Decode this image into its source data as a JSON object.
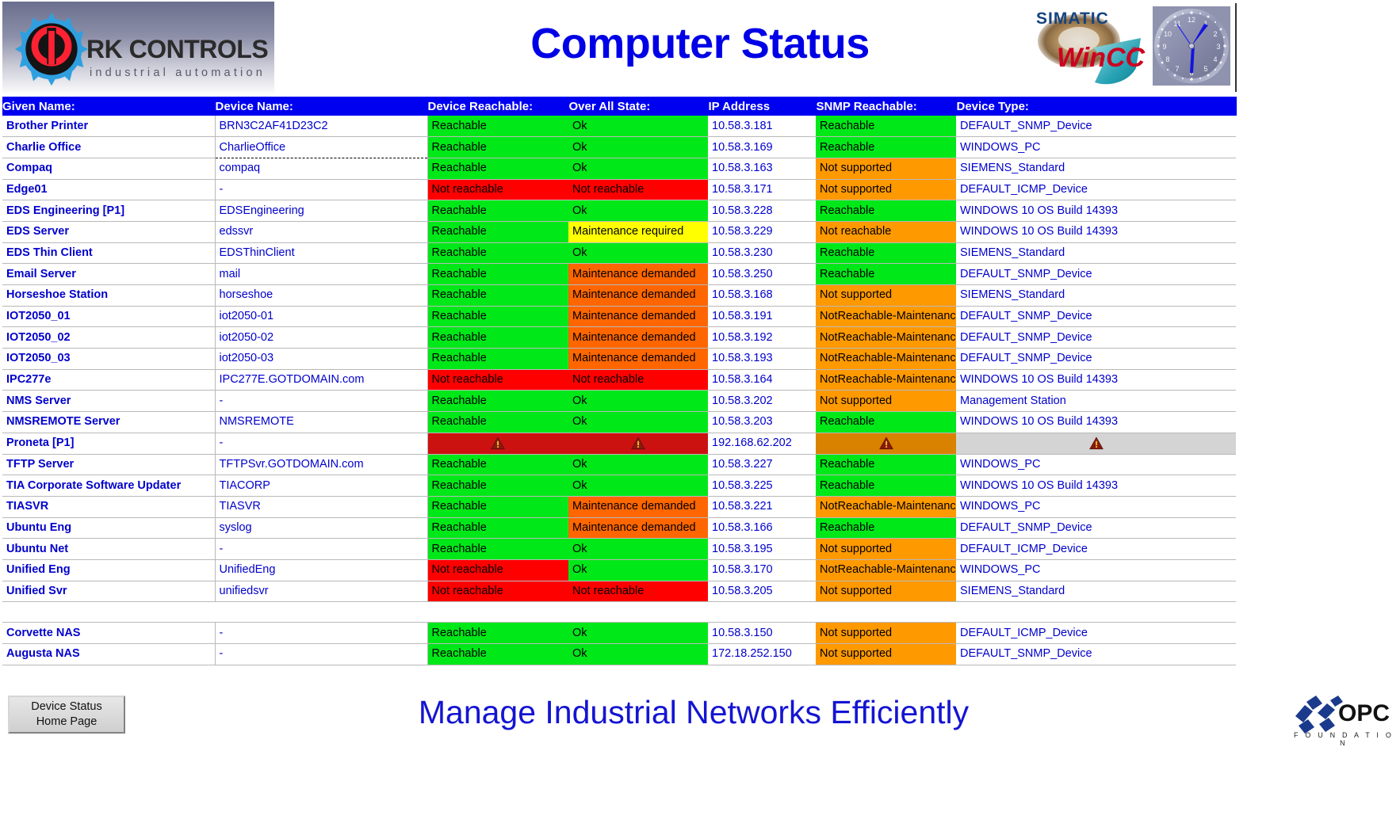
{
  "header": {
    "title": "Computer Status",
    "logo": {
      "name": "RK CONTROLS",
      "tagline": "industrial automation",
      "icon": "gear-power-icon"
    },
    "wincc_logo": {
      "line1": "SIMATIC",
      "line2": "WinCC",
      "trademark": "®",
      "icon": "simatic-wincc-logo"
    },
    "clock": {
      "icon": "analog-clock",
      "numerals": [
        "12",
        "1",
        "2",
        "3",
        "4",
        "5",
        "6",
        "7",
        "8",
        "9",
        "10",
        "11"
      ],
      "time": "1:30"
    }
  },
  "table": {
    "columns": [
      "Given Name:",
      "Device Name:",
      "Device Reachable:",
      "Over All State:",
      "IP Address",
      "SNMP Reachable:",
      "Device Type:"
    ],
    "rows": [
      {
        "given_name": "Brother Printer",
        "device_name": "BRN3C2AF41D23C2",
        "device_reachable": "Reachable",
        "device_reachable_color": "green",
        "over_all_state": "Ok",
        "over_all_state_color": "green",
        "ip_address": "10.58.3.181",
        "snmp_reachable": "Reachable",
        "snmp_reachable_color": "green",
        "device_type": "DEFAULT_SNMP_Device"
      },
      {
        "given_name": "Charlie Office",
        "device_name": "CharlieOffice",
        "device_reachable": "Reachable",
        "device_reachable_color": "green",
        "over_all_state": "Ok",
        "over_all_state_color": "green",
        "ip_address": "10.58.3.169",
        "snmp_reachable": "Reachable",
        "snmp_reachable_color": "green",
        "device_type": "WINDOWS_PC"
      },
      {
        "given_name": "Compaq",
        "device_name": "compaq",
        "device_reachable": "Reachable",
        "device_reachable_color": "green",
        "over_all_state": "Ok",
        "over_all_state_color": "green",
        "ip_address": "10.58.3.163",
        "snmp_reachable": "Not supported",
        "snmp_reachable_color": "orange",
        "device_type": "SIEMENS_Standard"
      },
      {
        "given_name": "Edge01",
        "device_name": "-",
        "device_reachable": "Not reachable",
        "device_reachable_color": "red",
        "over_all_state": "Not reachable",
        "over_all_state_color": "red",
        "ip_address": "10.58.3.171",
        "snmp_reachable": "Not supported",
        "snmp_reachable_color": "orange",
        "device_type": "DEFAULT_ICMP_Device"
      },
      {
        "given_name": "EDS Engineering [P1]",
        "device_name": "EDSEngineering",
        "device_reachable": "Reachable",
        "device_reachable_color": "green",
        "over_all_state": "Ok",
        "over_all_state_color": "green",
        "ip_address": "10.58.3.228",
        "snmp_reachable": "Reachable",
        "snmp_reachable_color": "green",
        "device_type": "WINDOWS 10 OS Build 14393"
      },
      {
        "given_name": "EDS Server",
        "device_name": "edssvr",
        "device_reachable": "Reachable",
        "device_reachable_color": "green",
        "over_all_state": "Maintenance required",
        "over_all_state_color": "yellow",
        "ip_address": "10.58.3.229",
        "snmp_reachable": "Not reachable",
        "snmp_reachable_color": "orange",
        "device_type": "WINDOWS 10 OS Build 14393"
      },
      {
        "given_name": "EDS Thin Client",
        "device_name": "EDSThinClient",
        "device_reachable": "Reachable",
        "device_reachable_color": "green",
        "over_all_state": "Ok",
        "over_all_state_color": "green",
        "ip_address": "10.58.3.230",
        "snmp_reachable": "Reachable",
        "snmp_reachable_color": "green",
        "device_type": "SIEMENS_Standard"
      },
      {
        "given_name": "Email Server",
        "device_name": "mail",
        "device_reachable": "Reachable",
        "device_reachable_color": "green",
        "over_all_state": "Maintenance demanded",
        "over_all_state_color": "dorange",
        "ip_address": "10.58.3.250",
        "snmp_reachable": "Reachable",
        "snmp_reachable_color": "green",
        "device_type": "DEFAULT_SNMP_Device"
      },
      {
        "given_name": "Horseshoe Station",
        "device_name": "horseshoe",
        "device_reachable": "Reachable",
        "device_reachable_color": "green",
        "over_all_state": "Maintenance demanded",
        "over_all_state_color": "dorange",
        "ip_address": "10.58.3.168",
        "snmp_reachable": "Not supported",
        "snmp_reachable_color": "orange",
        "device_type": "SIEMENS_Standard"
      },
      {
        "given_name": "IOT2050_01",
        "device_name": "iot2050-01",
        "device_reachable": "Reachable",
        "device_reachable_color": "green",
        "over_all_state": "Maintenance demanded",
        "over_all_state_color": "dorange",
        "ip_address": "10.58.3.191",
        "snmp_reachable": "NotReachable-MaintenanceD",
        "snmp_reachable_color": "orange",
        "device_type": "DEFAULT_SNMP_Device"
      },
      {
        "given_name": "IOT2050_02",
        "device_name": "iot2050-02",
        "device_reachable": "Reachable",
        "device_reachable_color": "green",
        "over_all_state": "Maintenance demanded",
        "over_all_state_color": "dorange",
        "ip_address": "10.58.3.192",
        "snmp_reachable": "NotReachable-MaintenanceD",
        "snmp_reachable_color": "orange",
        "device_type": "DEFAULT_SNMP_Device"
      },
      {
        "given_name": "IOT2050_03",
        "device_name": "iot2050-03",
        "device_reachable": "Reachable",
        "device_reachable_color": "green",
        "over_all_state": "Maintenance demanded",
        "over_all_state_color": "dorange",
        "ip_address": "10.58.3.193",
        "snmp_reachable": "NotReachable-MaintenanceD",
        "snmp_reachable_color": "orange",
        "device_type": "DEFAULT_SNMP_Device"
      },
      {
        "given_name": "IPC277e",
        "device_name": "IPC277E.GOTDOMAIN.com",
        "device_reachable": "Not reachable",
        "device_reachable_color": "red",
        "over_all_state": "Not reachable",
        "over_all_state_color": "red",
        "ip_address": "10.58.3.164",
        "snmp_reachable": "NotReachable-MaintenanceD",
        "snmp_reachable_color": "orange",
        "device_type": "WINDOWS 10 OS Build 14393"
      },
      {
        "given_name": "NMS Server",
        "device_name": "-",
        "device_reachable": "Reachable",
        "device_reachable_color": "green",
        "over_all_state": "Ok",
        "over_all_state_color": "green",
        "ip_address": "10.58.3.202",
        "snmp_reachable": "Not supported",
        "snmp_reachable_color": "orange",
        "device_type": "Management Station"
      },
      {
        "given_name": "NMSREMOTE Server",
        "device_name": "NMSREMOTE",
        "device_reachable": "Reachable",
        "device_reachable_color": "green",
        "over_all_state": "Ok",
        "over_all_state_color": "green",
        "ip_address": "10.58.3.203",
        "snmp_reachable": "Reachable",
        "snmp_reachable_color": "green",
        "device_type": "WINDOWS 10 OS Build 14393"
      },
      {
        "given_name": "Proneta [P1]",
        "device_name": "-",
        "device_reachable": "",
        "device_reachable_color": "darkred",
        "device_reachable_icon": "warning-triangle-icon",
        "over_all_state": "",
        "over_all_state_color": "darkred",
        "over_all_state_icon": "warning-triangle-icon",
        "ip_address": "192.168.62.202",
        "snmp_reachable": "",
        "snmp_reachable_color": "darkorange",
        "snmp_reachable_icon": "warning-triangle-icon",
        "device_type": "",
        "device_type_color": "gray",
        "device_type_icon": "warning-triangle-icon"
      },
      {
        "given_name": "TFTP Server",
        "device_name": "TFTPSvr.GOTDOMAIN.com",
        "device_reachable": "Reachable",
        "device_reachable_color": "green",
        "over_all_state": "Ok",
        "over_all_state_color": "green",
        "ip_address": "10.58.3.227",
        "snmp_reachable": "Reachable",
        "snmp_reachable_color": "green",
        "device_type": "WINDOWS_PC"
      },
      {
        "given_name": "TIA Corporate Software Updater",
        "device_name": "TIACORP",
        "device_reachable": "Reachable",
        "device_reachable_color": "green",
        "over_all_state": "Ok",
        "over_all_state_color": "green",
        "ip_address": "10.58.3.225",
        "snmp_reachable": "Reachable",
        "snmp_reachable_color": "green",
        "device_type": "WINDOWS 10 OS Build 14393"
      },
      {
        "given_name": "TIASVR",
        "device_name": "TIASVR",
        "device_reachable": "Reachable",
        "device_reachable_color": "green",
        "over_all_state": "Maintenance demanded",
        "over_all_state_color": "dorange",
        "ip_address": "10.58.3.221",
        "snmp_reachable": "NotReachable-MaintenanceD",
        "snmp_reachable_color": "orange",
        "device_type": "WINDOWS_PC"
      },
      {
        "given_name": "Ubuntu Eng",
        "device_name": "syslog",
        "device_reachable": "Reachable",
        "device_reachable_color": "green",
        "over_all_state": "Maintenance demanded",
        "over_all_state_color": "dorange",
        "ip_address": "10.58.3.166",
        "snmp_reachable": "Reachable",
        "snmp_reachable_color": "green",
        "device_type": "DEFAULT_SNMP_Device"
      },
      {
        "given_name": "Ubuntu Net",
        "device_name": "-",
        "device_reachable": "Reachable",
        "device_reachable_color": "green",
        "over_all_state": "Ok",
        "over_all_state_color": "green",
        "ip_address": "10.58.3.195",
        "snmp_reachable": "Not supported",
        "snmp_reachable_color": "orange",
        "device_type": "DEFAULT_ICMP_Device"
      },
      {
        "given_name": "Unified Eng",
        "device_name": "UnifiedEng",
        "device_reachable": "Not reachable",
        "device_reachable_color": "red",
        "over_all_state": "Ok",
        "over_all_state_color": "green",
        "ip_address": "10.58.3.170",
        "snmp_reachable": "NotReachable-MaintenanceD",
        "snmp_reachable_color": "orange",
        "device_type": "WINDOWS_PC"
      },
      {
        "given_name": "Unified Svr",
        "device_name": "unifiedsvr",
        "device_reachable": "Not reachable",
        "device_reachable_color": "red",
        "over_all_state": "Not reachable",
        "over_all_state_color": "red",
        "ip_address": "10.58.3.205",
        "snmp_reachable": "Not supported",
        "snmp_reachable_color": "orange",
        "device_type": "SIEMENS_Standard"
      }
    ],
    "nas_rows": [
      {
        "given_name": "Corvette NAS",
        "device_name": "-",
        "device_reachable": "Reachable",
        "device_reachable_color": "green",
        "over_all_state": "Ok",
        "over_all_state_color": "green",
        "ip_address": "10.58.3.150",
        "snmp_reachable": "Not supported",
        "snmp_reachable_color": "orange",
        "device_type": "DEFAULT_ICMP_Device"
      },
      {
        "given_name": "Augusta NAS",
        "device_name": "-",
        "device_reachable": "Reachable",
        "device_reachable_color": "green",
        "over_all_state": "Ok",
        "over_all_state_color": "green",
        "ip_address": "172.18.252.150",
        "snmp_reachable": "Not supported",
        "snmp_reachable_color": "orange",
        "device_type": "DEFAULT_SNMP_Device"
      }
    ]
  },
  "footer": {
    "home_button_line1": "Device Status",
    "home_button_line2": "Home Page",
    "tagline": "Manage Industrial Networks Efficiently",
    "opc_logo_text": "OPC",
    "opc_foundation_text": "F O U N D A T I O N"
  },
  "colors": {
    "header_blue": "#0000F0",
    "text_blue": "#0000CC",
    "title_blue": "#0000E6",
    "green": "#00E818",
    "red": "#FF0000",
    "orange": "#FF9900",
    "yellow": "#FFFF00",
    "dark_orange": "#FF6600",
    "dark_red": "#CC1111",
    "gray": "#D4D4D4"
  }
}
